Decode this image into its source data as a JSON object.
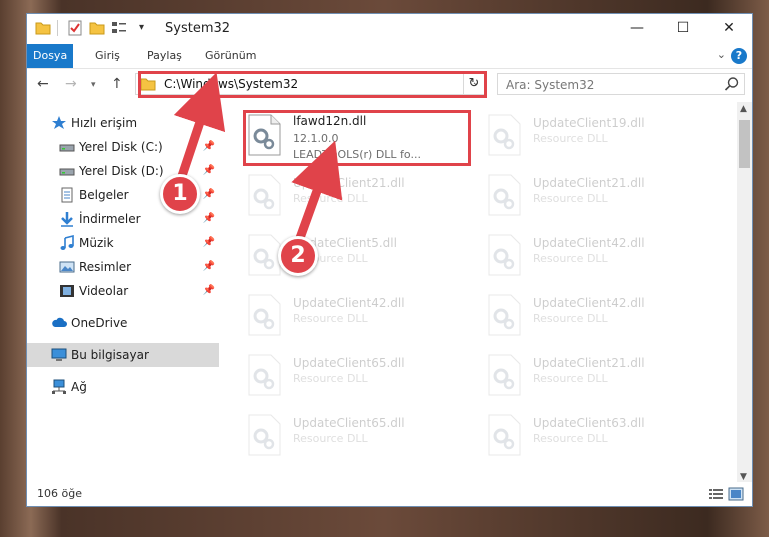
{
  "window": {
    "title": "System32"
  },
  "ribbon": {
    "tabs": [
      {
        "label": "Dosya",
        "active": true
      },
      {
        "label": "Giriş"
      },
      {
        "label": "Paylaş"
      },
      {
        "label": "Görünüm"
      }
    ],
    "help": "?"
  },
  "nav": {
    "address": "C:\\Windows\\System32",
    "search_placeholder": "Ara: System32"
  },
  "sidebar": {
    "items": [
      {
        "label": "Hızlı erişim",
        "icon": "star-icon"
      },
      {
        "label": "Yerel Disk (C:)",
        "icon": "drive-icon",
        "pinned": true
      },
      {
        "label": "Yerel Disk (D:)",
        "icon": "drive-icon",
        "pinned": true
      },
      {
        "label": "Belgeler",
        "icon": "documents-icon",
        "pinned": true
      },
      {
        "label": "İndirmeler",
        "icon": "download-icon",
        "pinned": true
      },
      {
        "label": "Müzik",
        "icon": "music-icon",
        "pinned": true
      },
      {
        "label": "Resimler",
        "icon": "pictures-icon",
        "pinned": true
      },
      {
        "label": "Videolar",
        "icon": "videos-icon",
        "pinned": true
      },
      {
        "label": "OneDrive",
        "icon": "cloud-icon"
      },
      {
        "label": "Bu bilgisayar",
        "icon": "computer-icon",
        "selected": true
      },
      {
        "label": "Ağ",
        "icon": "network-icon"
      }
    ]
  },
  "files": [
    {
      "name": "lfawd12n.dll",
      "version": "12.1.0.0",
      "desc": "LEADTOOLS(r) DLL fo..."
    },
    {
      "name": "UpdateClient19.dll",
      "desc": "Resource DLL"
    },
    {
      "name": "UpdateClient21.dll",
      "desc": "Resource DLL"
    },
    {
      "name": "UpdateClient21.dll",
      "desc": "Resource DLL"
    },
    {
      "name": "UpdateClient5.dll",
      "desc": "Resource DLL"
    },
    {
      "name": "UpdateClient42.dll",
      "desc": "Resource DLL"
    },
    {
      "name": "UpdateClient42.dll",
      "desc": "Resource DLL"
    },
    {
      "name": "UpdateClient42.dll",
      "desc": "Resource DLL"
    },
    {
      "name": "UpdateClient65.dll",
      "desc": "Resource DLL"
    },
    {
      "name": "UpdateClient21.dll",
      "desc": "Resource DLL"
    },
    {
      "name": "UpdateClient65.dll",
      "desc": "Resource DLL"
    },
    {
      "name": "UpdateClient63.dll",
      "desc": "Resource DLL"
    }
  ],
  "status": {
    "count": "106 öğe"
  },
  "callouts": {
    "one": "1",
    "two": "2"
  },
  "colors": {
    "accent": "#1979ca",
    "highlight": "#e0434a",
    "selection": "#d9d9d9"
  }
}
